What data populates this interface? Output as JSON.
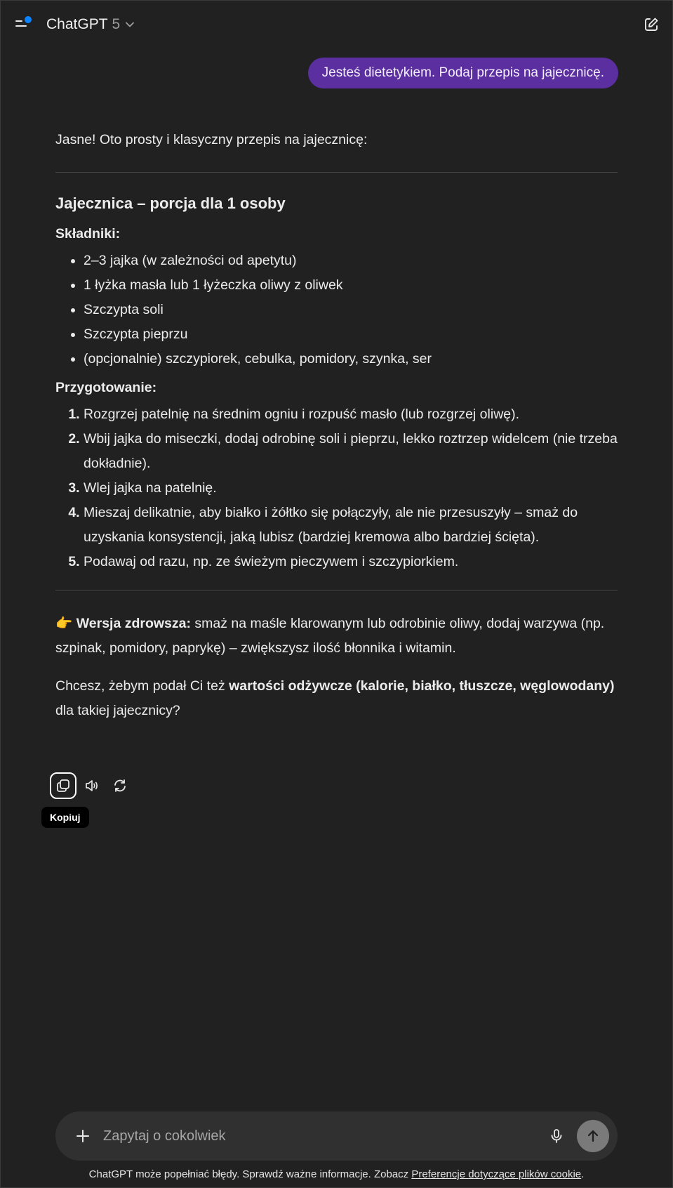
{
  "header": {
    "model_name": "ChatGPT",
    "model_version": "5"
  },
  "user_message": "Jesteś dietetykiem. Podaj przepis na jajecznicę.",
  "assistant": {
    "intro": "Jasne! Oto prosty i klasyczny przepis na jajecznicę:",
    "recipe_title": "Jajecznica – porcja dla 1 osoby",
    "ingredients_label": "Składniki:",
    "ingredients": [
      "2–3 jajka (w zależności od apetytu)",
      "1 łyżka masła lub 1 łyżeczka oliwy z oliwek",
      "Szczypta soli",
      "Szczypta pieprzu",
      "(opcjonalnie) szczypiorek, cebulka, pomidory, szynka, ser"
    ],
    "preparation_label": "Przygotowanie:",
    "steps": [
      "Rozgrzej patelnię na średnim ogniu i rozpuść masło (lub rozgrzej oliwę).",
      "Wbij jajka do miseczki, dodaj odrobinę soli i pieprzu, lekko roztrzep widelcem (nie trzeba dokładnie).",
      "Wlej jajka na patelnię.",
      "Mieszaj delikatnie, aby białko i żółtko się połączyły, ale nie przesuszyły – smaż do uzyskania konsystencji, jaką lubisz (bardziej kremowa albo bardziej ścięta).",
      "Podawaj od razu, np. ze świeżym pieczywem i szczypiorkiem."
    ],
    "tip_emoji": "👉",
    "tip_bold": "Wersja zdrowsza:",
    "tip_text": " smaż na maśle klarowanym lub odrobinie oliwy, dodaj warzywa (np. szpinak, pomidory, paprykę) – zwiększysz ilość błonnika i witamin.",
    "question_pre": "Chcesz, żebym podał Ci też ",
    "question_bold": "wartości odżywcze (kalorie, białko, tłuszcze, węglowodany)",
    "question_post": " dla takiej jajecznicy?"
  },
  "actions": {
    "copy_tooltip": "Kopiuj"
  },
  "composer": {
    "placeholder": "Zapytaj o cokolwiek"
  },
  "footer": {
    "text": "ChatGPT może popełniać błędy. Sprawdź ważne informacje. Zobacz ",
    "link": "Preferencje dotyczące plików cookie",
    "end": "."
  },
  "colors": {
    "background": "#212121",
    "user_bubble": "#5b2fa0",
    "notification_dot": "#0a84ff",
    "composer": "#303030"
  }
}
